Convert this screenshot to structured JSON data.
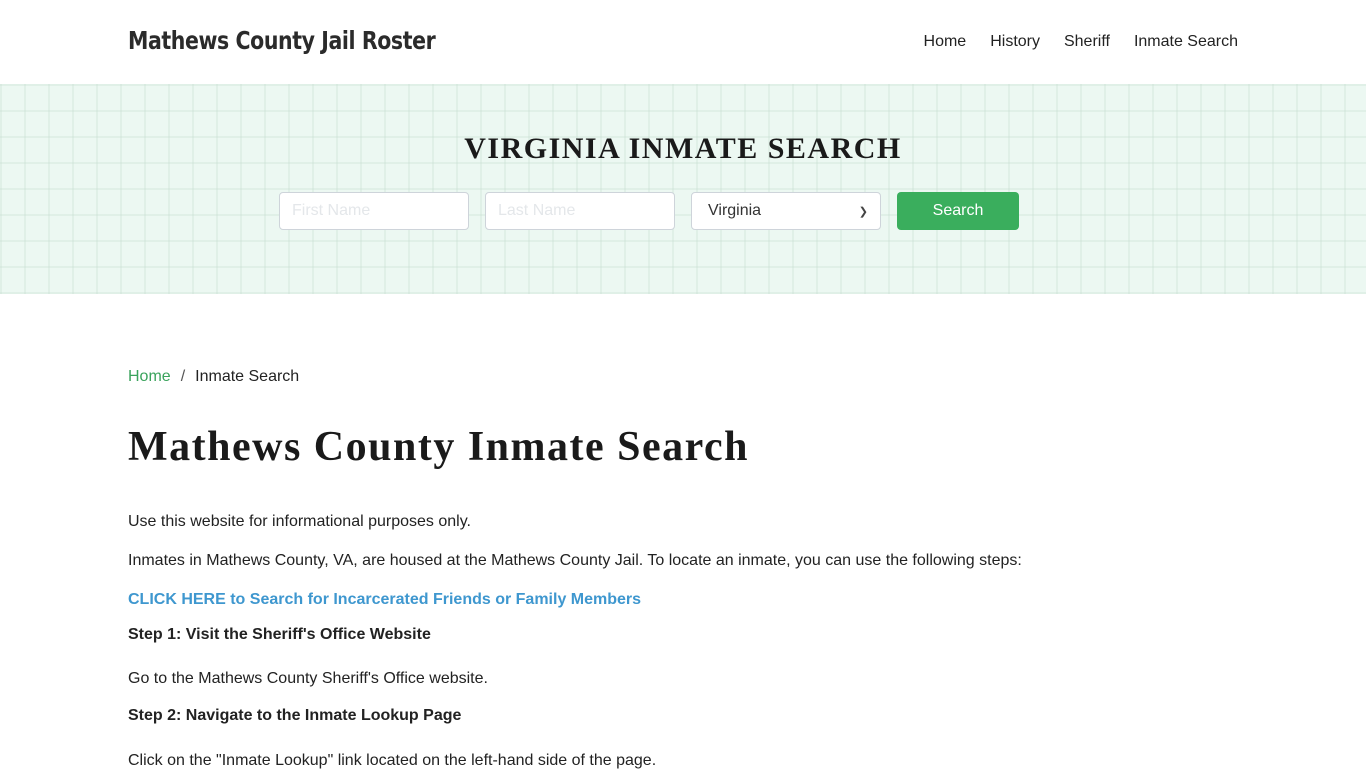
{
  "header": {
    "brand": "Mathews County Jail Roster",
    "nav": [
      "Home",
      "History",
      "Sheriff",
      "Inmate Search"
    ]
  },
  "hero": {
    "title": "VIRGINIA INMATE SEARCH",
    "first_name_placeholder": "First Name",
    "first_name_value": "",
    "last_name_placeholder": "Last Name",
    "last_name_value": "",
    "state_selected": "Virginia",
    "search_label": "Search"
  },
  "breadcrumb": {
    "home": "Home",
    "separator": "/",
    "current": "Inmate Search"
  },
  "content": {
    "heading": "Mathews County Inmate Search",
    "disclaimer": "Use this website for informational purposes only.",
    "intro": "Inmates in Mathews County, VA, are housed at the Mathews County Jail. To locate an inmate, you can use the following steps:",
    "cta_link": "CLICK HERE to Search for Incarcerated Friends or Family Members",
    "step1_title": "Step 1: Visit the Sheriff's Office Website",
    "step1_body": "Go to the Mathews County Sheriff's Office website.",
    "step2_title": "Step 2: Navigate to the Inmate Lookup Page",
    "step2_body": "Click on the \"Inmate Lookup\" link located on the left-hand side of the page."
  },
  "colors": {
    "accent_green": "#3aae5d",
    "link_blue": "#3e97cf",
    "hero_bg": "#ecf8f2"
  }
}
